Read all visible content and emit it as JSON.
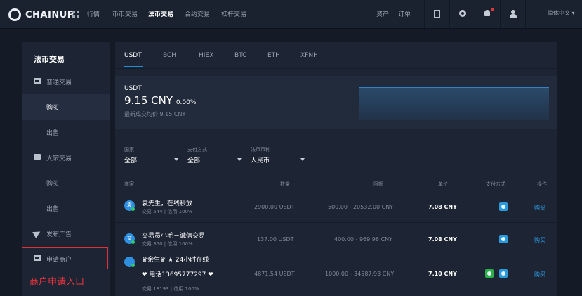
{
  "topbar": {
    "logo": "CHAINUP",
    "nav": [
      "行情",
      "币币交易",
      "法币交易",
      "合约交易",
      "杠杆交易"
    ],
    "active_nav": "法币交易",
    "right": [
      "资产",
      "订单"
    ],
    "language": "简体中文"
  },
  "sidebar": {
    "title": "法币交易",
    "items": [
      {
        "label": "普通交易",
        "type": "group",
        "icon": "list-icon"
      },
      {
        "label": "购买",
        "type": "sub",
        "selected": true
      },
      {
        "label": "出售",
        "type": "sub"
      },
      {
        "label": "大宗交易",
        "type": "group",
        "icon": "print-icon"
      },
      {
        "label": "购买",
        "type": "sub"
      },
      {
        "label": "出售",
        "type": "sub"
      },
      {
        "label": "发布广告",
        "type": "group",
        "icon": "send-icon"
      },
      {
        "label": "申请商户",
        "type": "group",
        "icon": "card-icon"
      }
    ],
    "annotation": "商户申请入口"
  },
  "main": {
    "tabs": [
      "USDT",
      "BCH",
      "HIEX",
      "BTC",
      "ETH",
      "XFNH"
    ],
    "active_tab": "USDT",
    "price": {
      "coin": "USDT",
      "value": "9.15 CNY",
      "change": "0.00%",
      "last": "最新成交均价 9.15 CNY"
    },
    "filters": [
      {
        "label": "国家",
        "value": "全部"
      },
      {
        "label": "支付方式",
        "value": "全部"
      },
      {
        "label": "法币币种",
        "value": "人民币"
      }
    ],
    "columns": [
      "商家",
      "数量",
      "限额",
      "单价",
      "支付方式",
      "操作"
    ],
    "rows": [
      {
        "avatar": "袁",
        "name": "袁先生，在线秒放",
        "stats": "交易 544 | 信用 100%",
        "qty": "2900.00 USDT",
        "limit": "500.00 - 20532.00 CNY",
        "price": "7.08 CNY",
        "pay": [
          "alipay"
        ],
        "action": "购买"
      },
      {
        "avatar": "交",
        "name": "交易员小毛－诚信交易",
        "stats": "交易 850 | 信用 100%",
        "qty": "137.00 USDT",
        "limit": "400.00 - 969.96 CNY",
        "price": "7.08 CNY",
        "pay": [
          "alipay"
        ],
        "action": "购买"
      },
      {
        "avatar": "",
        "name_line1": "♛余生♛ ★ 24小时在线",
        "name_line2": "❤ 电话13695777297 ❤",
        "stats": "交易 18193 | 信用 100%",
        "qty": "4871.54 USDT",
        "limit": "1000.00 - 34587.93 CNY",
        "price": "7.10 CNY",
        "pay": [
          "wechat",
          "alipay"
        ],
        "action": "购买"
      }
    ]
  }
}
